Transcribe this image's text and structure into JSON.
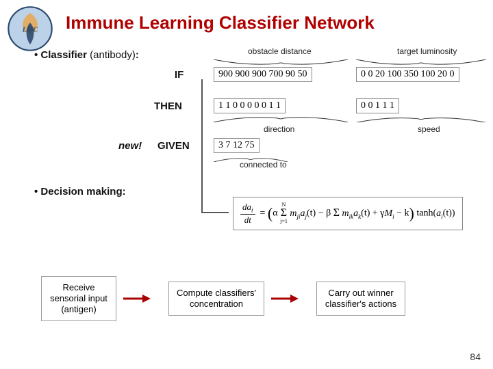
{
  "title": "Immune Learning Classifier Network",
  "classifier": {
    "bullet": "• Classifier",
    "paren": " (antibody)",
    "colon": ":",
    "annot_obstacle": "obstacle distance",
    "annot_target": "target luminosity",
    "if_kw": "IF",
    "if_box1": "900 900 900 700 90 50",
    "if_box2": "0   0  20 100 350 100 20 0",
    "then_kw": "THEN",
    "then_box1": "1  1  0  0  0  0  0  1  1",
    "then_box2": "0   0   1   1   1",
    "annot_direction": "direction",
    "annot_speed": "speed",
    "new_kw": "new!",
    "given_kw": "GIVEN",
    "given_box": "3  7  12  75",
    "annot_connected": "connected to"
  },
  "decision": {
    "bullet": "• Decision making:",
    "formula_html": "dai/dt = (α Σ mji aj(t) − β Σ mik ak(t) + γ Mi − k) tanh(ai(t))"
  },
  "flow": {
    "box1": "Receive sensorial input (antigen)",
    "box2": "Compute classifiers' concentration",
    "box3": "Carry out winner classifier's actions"
  },
  "pagenum": "84"
}
